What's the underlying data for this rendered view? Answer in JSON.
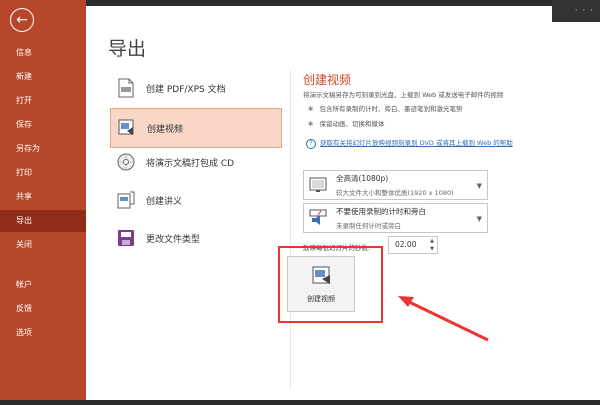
{
  "sidebar": {
    "back_icon": "back-arrow-icon",
    "items": [
      {
        "label": "信息"
      },
      {
        "label": "新建"
      },
      {
        "label": "打开"
      },
      {
        "label": "保存"
      },
      {
        "label": "另存为"
      },
      {
        "label": "打印"
      },
      {
        "label": "共享"
      },
      {
        "label": "导出",
        "active": true
      },
      {
        "label": "关闭"
      },
      {
        "label": "帐户"
      },
      {
        "label": "反馈"
      },
      {
        "label": "选项"
      }
    ],
    "colors": {
      "bg": "#b7472a",
      "active_bg": "#8f2d18"
    }
  },
  "main": {
    "title": "导出",
    "options": [
      {
        "label": "创建 PDF/XPS 文档",
        "icon": "pdf-document-icon"
      },
      {
        "label": "创建视频",
        "icon": "video-icon",
        "active": true
      },
      {
        "label": "将演示文稿打包成 CD",
        "icon": "cd-icon"
      },
      {
        "label": "创建讲义",
        "icon": "handout-icon"
      },
      {
        "label": "更改文件类型",
        "icon": "file-type-icon"
      }
    ]
  },
  "right": {
    "title": "创建视频",
    "description": "将演示文稿另存为可刻录到光盘、上载到 Web 或发送电子邮件的视频",
    "bullets": [
      "包含所有录制的计时、旁白、墨迹笔划和激光笔势",
      "保留动画、切换和媒体"
    ],
    "help_link": "获取有关将幻灯片放映视频刻录到 DVD 或将其上载到 Web 的帮助",
    "quality": {
      "title": "全高清(1080p)",
      "subtitle": "较大文件大小和整体优质(1920 x 1080)"
    },
    "timing": {
      "title": "不要使用录制的计时和旁白",
      "subtitle": "未录制任何计时或旁白"
    },
    "seconds_label": "放映每张幻灯片的秒数:",
    "seconds_value": "02.00",
    "create_button": "创建视频",
    "accent": "#d24726",
    "highlight_color": "#e33333"
  }
}
